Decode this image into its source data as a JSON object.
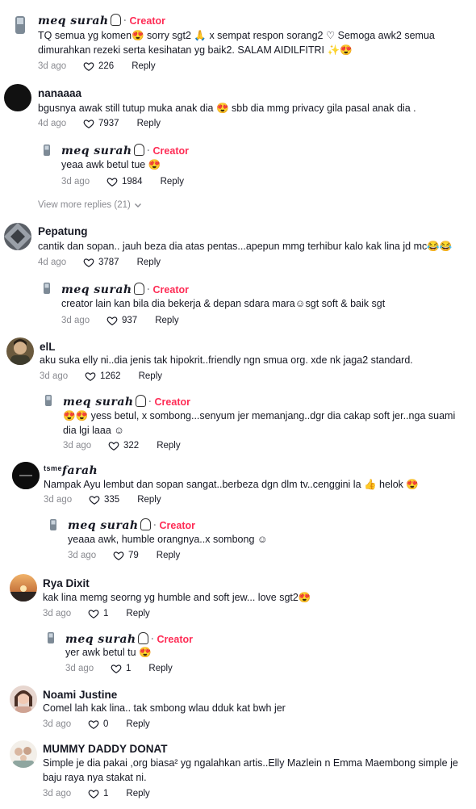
{
  "comments": [
    {
      "user": "meq surah",
      "creator": "Creator",
      "sep": "·",
      "text": "TQ semua yg komen😍 sorry sgt2 🙏 x sempat respon sorang2 ♡ Semoga awk2 semua dimurahkan rezeki serta kesihatan yg baik2. SALAM AIDILFITRI ✨😍",
      "date": "3d ago",
      "likes": "226",
      "reply": "Reply"
    },
    {
      "user": "nanaaaa",
      "text": "bgusnya awak still tutup muka anak dia 😍 sbb dia mmg privacy gila pasal anak dia .",
      "date": "4d ago",
      "likes": "7937",
      "reply": "Reply"
    },
    {
      "user": "meq surah",
      "creator": "Creator",
      "sep": "·",
      "text": "yeaa awk betul tue 😍",
      "date": "3d ago",
      "likes": "1984",
      "reply": "Reply"
    },
    {
      "user": "Pepatung",
      "text": "cantik dan sopan.. jauh beza dia atas pentas...apepun mmg terhibur kalo kak lina jd mc😂😂",
      "date": "4d ago",
      "likes": "3787",
      "reply": "Reply"
    },
    {
      "user": "meq surah",
      "creator": "Creator",
      "sep": "·",
      "text": "creator lain kan bila dia bekerja & depan sdara mara☺sgt soft & baik sgt",
      "date": "3d ago",
      "likes": "937",
      "reply": "Reply"
    },
    {
      "user": "elL",
      "text": "aku suka elly ni..dia jenis tak hipokrit..friendly ngn smua org. xde nk jaga2 standard.",
      "date": "3d ago",
      "likes": "1262",
      "reply": "Reply"
    },
    {
      "user": "meq surah",
      "creator": "Creator",
      "sep": "·",
      "text": "😍😍 yess betul, x sombong...senyum jer memanjang..dgr dia cakap soft jer..nga suami dia lgi laaa ☺",
      "date": "3d ago",
      "likes": "322",
      "reply": "Reply"
    },
    {
      "user": "farah",
      "text": "Nampak Ayu lembut dan sopan sangat..berbeza dgn dlm tv..cenggini la 👍 helok 😍",
      "date": "3d ago",
      "likes": "335",
      "reply": "Reply",
      "avatar_label": "tsme"
    },
    {
      "user": "meq surah",
      "creator": "Creator",
      "sep": "·",
      "text": "yeaaa awk, humble orangnya..x sombong ☺",
      "date": "3d ago",
      "likes": "79",
      "reply": "Reply"
    },
    {
      "user": "Rya Dixit",
      "text": "kak lina memg seorng yg humble and soft jew... love sgt2😍",
      "date": "3d ago",
      "likes": "1",
      "reply": "Reply"
    },
    {
      "user": "meq surah",
      "creator": "Creator",
      "sep": "·",
      "text": "yer awk betul tu 😍",
      "date": "3d ago",
      "likes": "1",
      "reply": "Reply"
    },
    {
      "user": "Noami Justine",
      "text": "Comel lah kak lina.. tak smbong wlau dduk kat bwh jer",
      "date": "3d ago",
      "likes": "0",
      "reply": "Reply"
    },
    {
      "user": "MUMMY DADDY DONAT",
      "text": "Simple je dia pakai ,org biasa² yg ngalahkan artis..Elly Mazlein n Emma Maembong simple je baju raya nya stakat ni.",
      "date": "3d ago",
      "likes": "1",
      "reply": "Reply"
    }
  ],
  "view_more": "View more replies (21)",
  "colors": {
    "creator": "#fe2c55",
    "meta": "#8a8b91",
    "text": "#161823"
  }
}
